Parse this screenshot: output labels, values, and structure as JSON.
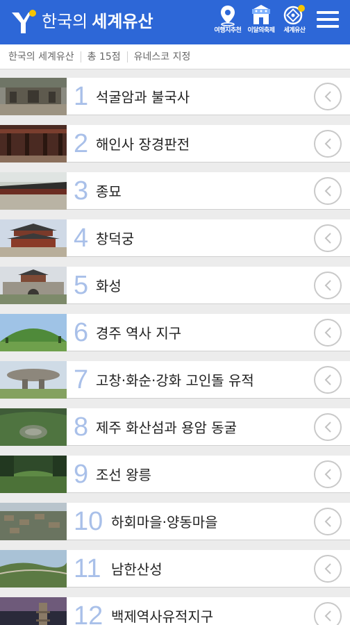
{
  "header": {
    "title_light": "한국의",
    "title_bold": "세계유산",
    "buttons": [
      {
        "label": "여행지추천",
        "icon": "map-pin-icon"
      },
      {
        "label": "이달의축제",
        "icon": "festival-tent-icon"
      },
      {
        "label": "세계유산",
        "icon": "world-heritage-icon"
      }
    ],
    "menu_icon": "hamburger-menu-icon"
  },
  "infobar": {
    "breadcrumb": "한국의 세계유산",
    "count": "총 15점",
    "note": "유네스코 지정"
  },
  "colors": {
    "brand_blue": "#2d67d7",
    "number_blue": "#a9c0e9",
    "badge_yellow": "#f5c400"
  },
  "items": [
    {
      "num": "1",
      "name": "석굴암과 불국사"
    },
    {
      "num": "2",
      "name": "해인사 장경판전"
    },
    {
      "num": "3",
      "name": "종묘"
    },
    {
      "num": "4",
      "name": "창덕궁"
    },
    {
      "num": "5",
      "name": "화성"
    },
    {
      "num": "6",
      "name": "경주 역사 지구"
    },
    {
      "num": "7",
      "name": "고창·화순·강화 고인돌 유적"
    },
    {
      "num": "8",
      "name": "제주 화산섬과 용암 동굴"
    },
    {
      "num": "9",
      "name": "조선 왕릉"
    },
    {
      "num": "10",
      "name": "하회마을·양동마을"
    },
    {
      "num": "11",
      "name": "남한산성"
    },
    {
      "num": "12",
      "name": "백제역사유적지구"
    }
  ]
}
